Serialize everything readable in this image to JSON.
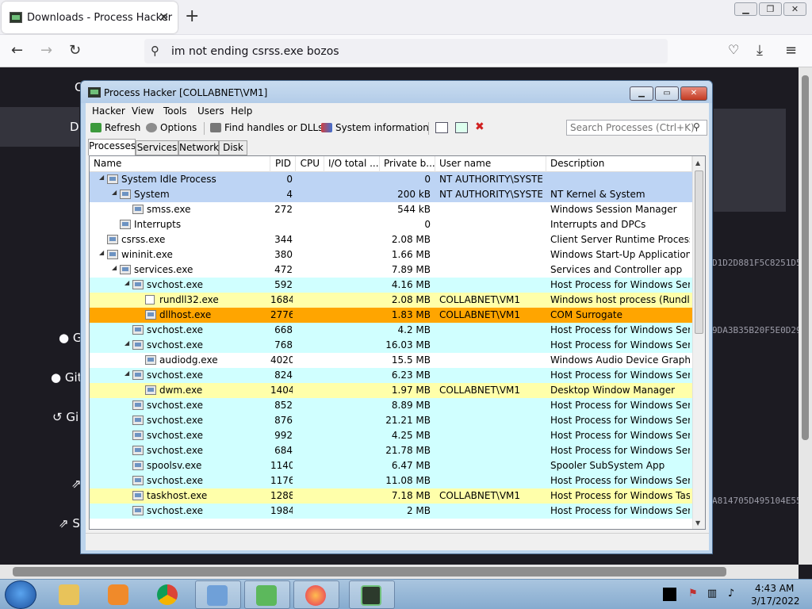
{
  "browser": {
    "tab_title": "Downloads - Process Hacker",
    "url_text": "im not ending csrss.exe bozos"
  },
  "page": {
    "side_links": [
      "C",
      "D",
      "G",
      "Git",
      "Gi",
      "S"
    ],
    "hashes": [
      "D1D2D881F5C8251D5",
      "9DA3B35B20F5E0D29",
      "A814705D495104E55"
    ]
  },
  "ph": {
    "title": "Process Hacker [COLLABNET\\VM1]",
    "menu": [
      "Hacker",
      "View",
      "Tools",
      "Users",
      "Help"
    ],
    "toolbar": {
      "refresh": "Refresh",
      "options": "Options",
      "find_handles": "Find handles or DLLs",
      "system_info": "System information"
    },
    "search_placeholder": "Search Processes (Ctrl+K)",
    "tabs": [
      "Processes",
      "Services",
      "Network",
      "Disk"
    ],
    "columns": [
      "Name",
      "PID",
      "CPU",
      "I/O total ...",
      "Private b...",
      "User name",
      "Description"
    ],
    "rows": [
      {
        "depth": 0,
        "exp": true,
        "name": "System Idle Process",
        "pid": "0",
        "cpu": "",
        "io": "",
        "priv": "0",
        "user": "NT AUTHORITY\\SYSTEM",
        "desc": "",
        "color": "#bdd4f4"
      },
      {
        "depth": 1,
        "exp": true,
        "name": "System",
        "pid": "4",
        "cpu": "",
        "io": "",
        "priv": "200 kB",
        "user": "NT AUTHORITY\\SYSTEM",
        "desc": "NT Kernel & System",
        "color": "#bdd4f4"
      },
      {
        "depth": 2,
        "exp": false,
        "name": "smss.exe",
        "pid": "272",
        "cpu": "",
        "io": "",
        "priv": "544 kB",
        "user": "",
        "desc": "Windows Session Manager",
        "color": "#ffffff"
      },
      {
        "depth": 1,
        "exp": false,
        "name": "Interrupts",
        "pid": "",
        "cpu": "",
        "io": "",
        "priv": "0",
        "user": "",
        "desc": "Interrupts and DPCs",
        "color": "#ffffff"
      },
      {
        "depth": 0,
        "exp": false,
        "name": "csrss.exe",
        "pid": "344",
        "cpu": "",
        "io": "",
        "priv": "2.08 MB",
        "user": "",
        "desc": "Client Server Runtime Process",
        "color": "#ffffff"
      },
      {
        "depth": 0,
        "exp": true,
        "name": "wininit.exe",
        "pid": "380",
        "cpu": "",
        "io": "",
        "priv": "1.66 MB",
        "user": "",
        "desc": "Windows Start-Up Application",
        "color": "#ffffff"
      },
      {
        "depth": 1,
        "exp": true,
        "name": "services.exe",
        "pid": "472",
        "cpu": "",
        "io": "",
        "priv": "7.89 MB",
        "user": "",
        "desc": "Services and Controller app",
        "color": "#ffffff"
      },
      {
        "depth": 2,
        "exp": true,
        "name": "svchost.exe",
        "pid": "592",
        "cpu": "",
        "io": "",
        "priv": "4.16 MB",
        "user": "",
        "desc": "Host Process for Windows Ser...",
        "color": "#d0ffff"
      },
      {
        "depth": 3,
        "exp": false,
        "doc": true,
        "name": "rundll32.exe",
        "pid": "1684",
        "cpu": "",
        "io": "",
        "priv": "2.08 MB",
        "user": "COLLABNET\\VM1",
        "desc": "Windows host process (Rundll...",
        "color": "#ffffaa"
      },
      {
        "depth": 3,
        "exp": false,
        "name": "dllhost.exe",
        "pid": "2776",
        "cpu": "",
        "io": "",
        "priv": "1.83 MB",
        "user": "COLLABNET\\VM1",
        "desc": "COM Surrogate",
        "color": "#ffa500"
      },
      {
        "depth": 2,
        "exp": false,
        "name": "svchost.exe",
        "pid": "668",
        "cpu": "",
        "io": "",
        "priv": "4.2 MB",
        "user": "",
        "desc": "Host Process for Windows Ser...",
        "color": "#d0ffff"
      },
      {
        "depth": 2,
        "exp": true,
        "name": "svchost.exe",
        "pid": "768",
        "cpu": "",
        "io": "",
        "priv": "16.03 MB",
        "user": "",
        "desc": "Host Process for Windows Ser...",
        "color": "#d0ffff"
      },
      {
        "depth": 3,
        "exp": false,
        "name": "audiodg.exe",
        "pid": "4020",
        "cpu": "",
        "io": "",
        "priv": "15.5 MB",
        "user": "",
        "desc": "Windows Audio Device Graph...",
        "color": "#ffffff"
      },
      {
        "depth": 2,
        "exp": true,
        "name": "svchost.exe",
        "pid": "824",
        "cpu": "",
        "io": "",
        "priv": "6.23 MB",
        "user": "",
        "desc": "Host Process for Windows Ser...",
        "color": "#d0ffff"
      },
      {
        "depth": 3,
        "exp": false,
        "name": "dwm.exe",
        "pid": "1404",
        "cpu": "",
        "io": "",
        "priv": "1.97 MB",
        "user": "COLLABNET\\VM1",
        "desc": "Desktop Window Manager",
        "color": "#ffffaa"
      },
      {
        "depth": 2,
        "exp": false,
        "name": "svchost.exe",
        "pid": "852",
        "cpu": "",
        "io": "",
        "priv": "8.89 MB",
        "user": "",
        "desc": "Host Process for Windows Ser...",
        "color": "#d0ffff"
      },
      {
        "depth": 2,
        "exp": false,
        "name": "svchost.exe",
        "pid": "876",
        "cpu": "",
        "io": "",
        "priv": "21.21 MB",
        "user": "",
        "desc": "Host Process for Windows Ser...",
        "color": "#d0ffff"
      },
      {
        "depth": 2,
        "exp": false,
        "name": "svchost.exe",
        "pid": "992",
        "cpu": "",
        "io": "",
        "priv": "4.25 MB",
        "user": "",
        "desc": "Host Process for Windows Ser...",
        "color": "#d0ffff"
      },
      {
        "depth": 2,
        "exp": false,
        "name": "svchost.exe",
        "pid": "684",
        "cpu": "",
        "io": "",
        "priv": "21.78 MB",
        "user": "",
        "desc": "Host Process for Windows Ser...",
        "color": "#d0ffff"
      },
      {
        "depth": 2,
        "exp": false,
        "name": "spoolsv.exe",
        "pid": "1140",
        "cpu": "",
        "io": "",
        "priv": "6.47 MB",
        "user": "",
        "desc": "Spooler SubSystem App",
        "color": "#d0ffff"
      },
      {
        "depth": 2,
        "exp": false,
        "name": "svchost.exe",
        "pid": "1176",
        "cpu": "",
        "io": "",
        "priv": "11.08 MB",
        "user": "",
        "desc": "Host Process for Windows Ser...",
        "color": "#d0ffff"
      },
      {
        "depth": 2,
        "exp": false,
        "name": "taskhost.exe",
        "pid": "1288",
        "cpu": "",
        "io": "",
        "priv": "7.18 MB",
        "user": "COLLABNET\\VM1",
        "desc": "Host Process for Windows Tas...",
        "color": "#ffffaa"
      },
      {
        "depth": 2,
        "exp": false,
        "name": "svchost.exe",
        "pid": "1984",
        "cpu": "",
        "io": "",
        "priv": "2 MB",
        "user": "",
        "desc": "Host Process for Windows Ser...",
        "color": "#d0ffff"
      }
    ]
  },
  "taskbar": {
    "time": "4:43 AM",
    "date": "3/17/2022"
  }
}
